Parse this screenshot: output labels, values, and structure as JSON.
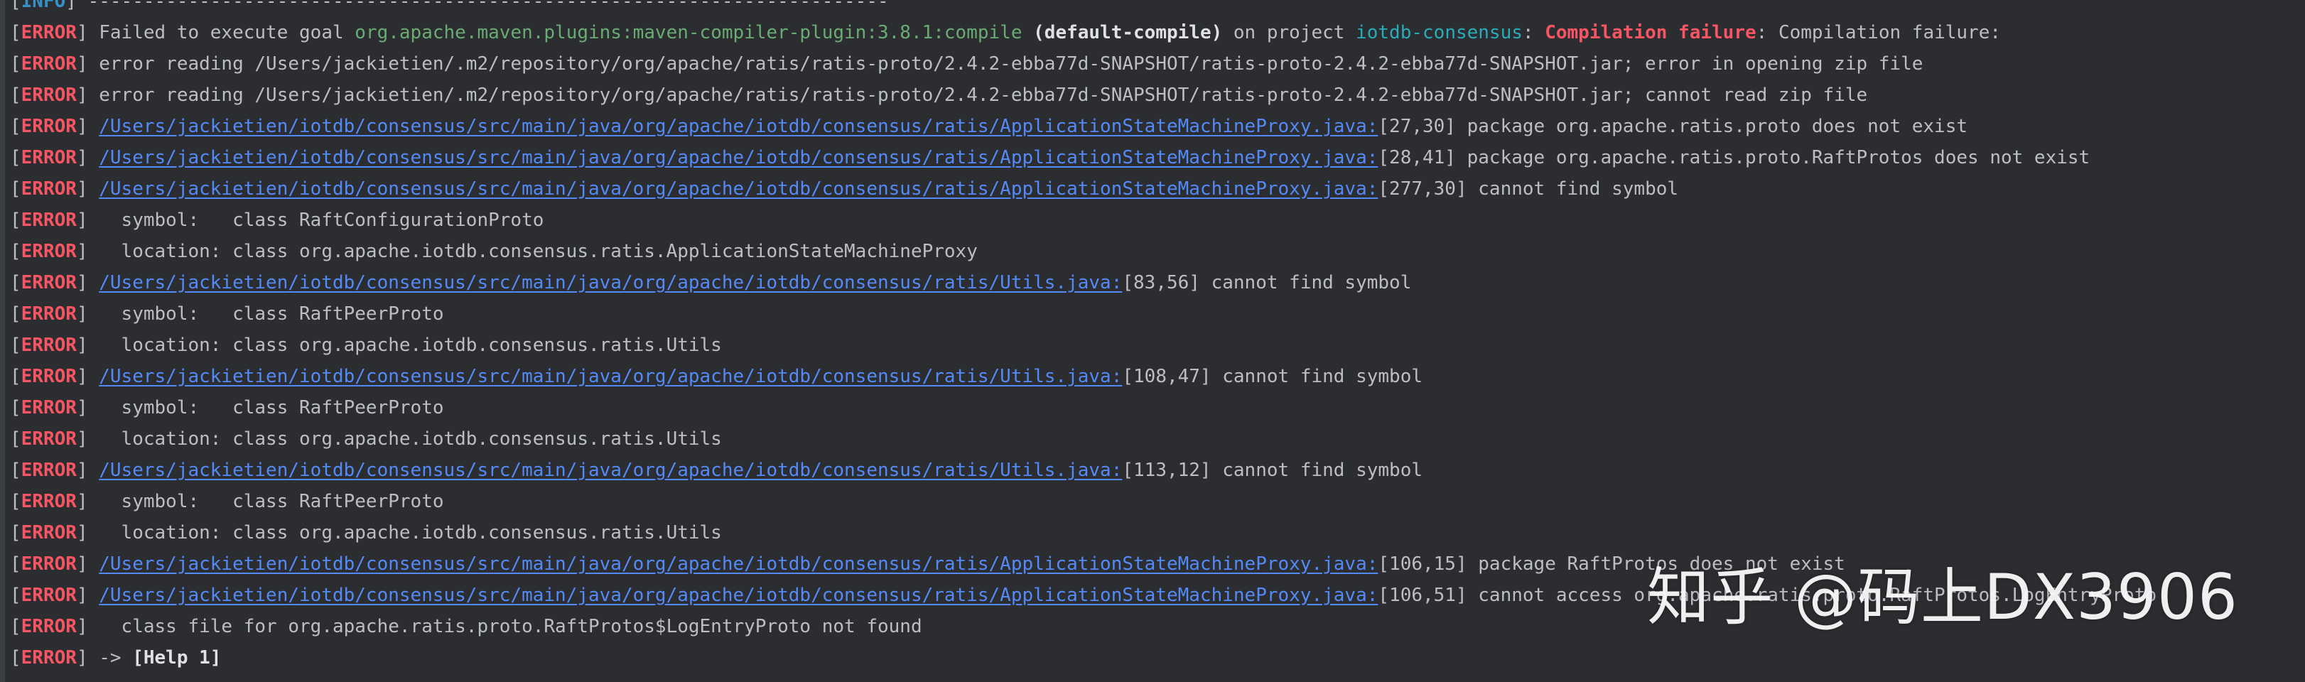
{
  "colors": {
    "background": "#2b2d30",
    "text": "#bcbec4",
    "info_tag": "#3592c4",
    "error_tag": "#f75464",
    "plugin": "#6aab73",
    "project": "#2aacb8",
    "link": "#548af7"
  },
  "watermark": "知乎 @码上DX3906",
  "lines": [
    {
      "tag": "INFO",
      "segments": [
        {
          "style": "msg",
          "text": " ------------------------------------------------------------------------"
        }
      ]
    },
    {
      "tag": "ERROR",
      "segments": [
        {
          "style": "msg",
          "text": " Failed to execute goal "
        },
        {
          "style": "plugin",
          "text": "org.apache.maven.plugins:maven-compiler-plugin:3.8.1:compile"
        },
        {
          "style": "msg",
          "text": " "
        },
        {
          "style": "bold",
          "text": "(default-compile)"
        },
        {
          "style": "msg",
          "text": " on project "
        },
        {
          "style": "proj",
          "text": "iotdb-consensus"
        },
        {
          "style": "msg",
          "text": ": "
        },
        {
          "style": "fail",
          "text": "Compilation failure"
        },
        {
          "style": "msg",
          "text": ": Compilation failure:"
        }
      ]
    },
    {
      "tag": "ERROR",
      "segments": [
        {
          "style": "msg",
          "text": " error reading /Users/jackietien/.m2/repository/org/apache/ratis/ratis-proto/2.4.2-ebba77d-SNAPSHOT/ratis-proto-2.4.2-ebba77d-SNAPSHOT.jar; error in opening zip file"
        }
      ]
    },
    {
      "tag": "ERROR",
      "segments": [
        {
          "style": "msg",
          "text": " error reading /Users/jackietien/.m2/repository/org/apache/ratis/ratis-proto/2.4.2-ebba77d-SNAPSHOT/ratis-proto-2.4.2-ebba77d-SNAPSHOT.jar; cannot read zip file"
        }
      ]
    },
    {
      "tag": "ERROR",
      "segments": [
        {
          "style": "msg",
          "text": " "
        },
        {
          "style": "link",
          "text": "/Users/jackietien/iotdb/consensus/src/main/java/org/apache/iotdb/consensus/ratis/ApplicationStateMachineProxy.java:"
        },
        {
          "style": "msg",
          "text": "[27,30] package org.apache.ratis.proto does not exist"
        }
      ]
    },
    {
      "tag": "ERROR",
      "segments": [
        {
          "style": "msg",
          "text": " "
        },
        {
          "style": "link",
          "text": "/Users/jackietien/iotdb/consensus/src/main/java/org/apache/iotdb/consensus/ratis/ApplicationStateMachineProxy.java:"
        },
        {
          "style": "msg",
          "text": "[28,41] package org.apache.ratis.proto.RaftProtos does not exist"
        }
      ]
    },
    {
      "tag": "ERROR",
      "segments": [
        {
          "style": "msg",
          "text": " "
        },
        {
          "style": "link",
          "text": "/Users/jackietien/iotdb/consensus/src/main/java/org/apache/iotdb/consensus/ratis/ApplicationStateMachineProxy.java:"
        },
        {
          "style": "msg",
          "text": "[277,30] cannot find symbol"
        }
      ]
    },
    {
      "tag": "ERROR",
      "segments": [
        {
          "style": "msg",
          "text": "   symbol:   class RaftConfigurationProto"
        }
      ]
    },
    {
      "tag": "ERROR",
      "segments": [
        {
          "style": "msg",
          "text": "   location: class org.apache.iotdb.consensus.ratis.ApplicationStateMachineProxy"
        }
      ]
    },
    {
      "tag": "ERROR",
      "segments": [
        {
          "style": "msg",
          "text": " "
        },
        {
          "style": "link",
          "text": "/Users/jackietien/iotdb/consensus/src/main/java/org/apache/iotdb/consensus/ratis/Utils.java:"
        },
        {
          "style": "msg",
          "text": "[83,56] cannot find symbol"
        }
      ]
    },
    {
      "tag": "ERROR",
      "segments": [
        {
          "style": "msg",
          "text": "   symbol:   class RaftPeerProto"
        }
      ]
    },
    {
      "tag": "ERROR",
      "segments": [
        {
          "style": "msg",
          "text": "   location: class org.apache.iotdb.consensus.ratis.Utils"
        }
      ]
    },
    {
      "tag": "ERROR",
      "segments": [
        {
          "style": "msg",
          "text": " "
        },
        {
          "style": "link",
          "text": "/Users/jackietien/iotdb/consensus/src/main/java/org/apache/iotdb/consensus/ratis/Utils.java:"
        },
        {
          "style": "msg",
          "text": "[108,47] cannot find symbol"
        }
      ]
    },
    {
      "tag": "ERROR",
      "segments": [
        {
          "style": "msg",
          "text": "   symbol:   class RaftPeerProto"
        }
      ]
    },
    {
      "tag": "ERROR",
      "segments": [
        {
          "style": "msg",
          "text": "   location: class org.apache.iotdb.consensus.ratis.Utils"
        }
      ]
    },
    {
      "tag": "ERROR",
      "segments": [
        {
          "style": "msg",
          "text": " "
        },
        {
          "style": "link",
          "text": "/Users/jackietien/iotdb/consensus/src/main/java/org/apache/iotdb/consensus/ratis/Utils.java:"
        },
        {
          "style": "msg",
          "text": "[113,12] cannot find symbol"
        }
      ]
    },
    {
      "tag": "ERROR",
      "segments": [
        {
          "style": "msg",
          "text": "   symbol:   class RaftPeerProto"
        }
      ]
    },
    {
      "tag": "ERROR",
      "segments": [
        {
          "style": "msg",
          "text": "   location: class org.apache.iotdb.consensus.ratis.Utils"
        }
      ]
    },
    {
      "tag": "ERROR",
      "segments": [
        {
          "style": "msg",
          "text": " "
        },
        {
          "style": "link",
          "text": "/Users/jackietien/iotdb/consensus/src/main/java/org/apache/iotdb/consensus/ratis/ApplicationStateMachineProxy.java:"
        },
        {
          "style": "msg",
          "text": "[106,15] package RaftProtos does not exist"
        }
      ]
    },
    {
      "tag": "ERROR",
      "segments": [
        {
          "style": "msg",
          "text": " "
        },
        {
          "style": "link",
          "text": "/Users/jackietien/iotdb/consensus/src/main/java/org/apache/iotdb/consensus/ratis/ApplicationStateMachineProxy.java:"
        },
        {
          "style": "msg",
          "text": "[106,51] cannot access org.apache.ratis.proto.RaftProtos.LogEntryProto"
        }
      ]
    },
    {
      "tag": "ERROR",
      "segments": [
        {
          "style": "msg",
          "text": "   class file for org.apache.ratis.proto.RaftProtos$LogEntryProto not found"
        }
      ]
    },
    {
      "tag": "ERROR",
      "segments": [
        {
          "style": "msg",
          "text": " -> "
        },
        {
          "style": "help",
          "text": "[Help 1]"
        }
      ]
    }
  ]
}
